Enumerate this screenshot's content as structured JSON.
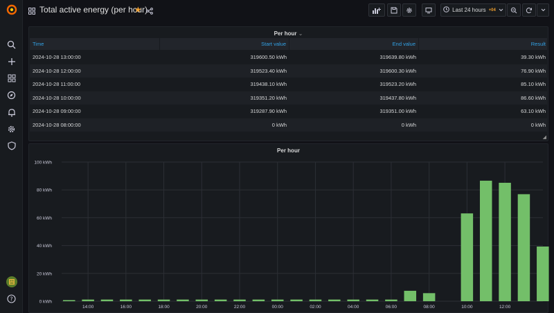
{
  "dashboard": {
    "title": "Total active energy (per hour)",
    "time_range": "Last 24 hours",
    "timezone_badge": "+04"
  },
  "sidebar": {
    "items": [
      "grafana-logo",
      "search-icon",
      "plus-icon",
      "dashboards-icon",
      "explore-icon",
      "bell-icon",
      "gear-icon",
      "shield-icon"
    ],
    "bottom": [
      "avatar",
      "help-icon"
    ]
  },
  "table_panel": {
    "title": "Per hour",
    "columns": [
      "Time",
      "Start value",
      "End value",
      "Result"
    ],
    "rows": [
      [
        "2024-10-28 13:00:00",
        "319600.50 kWh",
        "319639.80 kWh",
        "39.30 kWh"
      ],
      [
        "2024-10-28 12:00:00",
        "319523.40 kWh",
        "319600.30 kWh",
        "76.90 kWh"
      ],
      [
        "2024-10-28 11:00:00",
        "319438.10 kWh",
        "319523.20 kWh",
        "85.10 kWh"
      ],
      [
        "2024-10-28 10:00:00",
        "319351.20 kWh",
        "319437.80 kWh",
        "86.60 kWh"
      ],
      [
        "2024-10-28 09:00:00",
        "319287.90 kWh",
        "319351.00 kWh",
        "63.10 kWh"
      ],
      [
        "2024-10-28 08:00:00",
        "0 kWh",
        "0 kWh",
        "0 kWh"
      ]
    ]
  },
  "chart_panel": {
    "title": "Per hour"
  },
  "colors": {
    "bar": "#73bf69",
    "accent": "#33a2e5",
    "star": "#f2a02e"
  },
  "chart_data": {
    "type": "bar",
    "title": "Per hour",
    "xlabel": "",
    "ylabel": "",
    "x_ticks": [
      "14:00",
      "16:00",
      "18:00",
      "20:00",
      "22:00",
      "00:00",
      "02:00",
      "04:00",
      "06:00",
      "08:00",
      "10:00",
      "12:00"
    ],
    "y_ticks": [
      "0 kWh",
      "20 kWh",
      "40 kWh",
      "60 kWh",
      "80 kWh",
      "100 kWh"
    ],
    "ylim": [
      0,
      100
    ],
    "hours": [
      "13:00",
      "14:00",
      "15:00",
      "16:00",
      "17:00",
      "18:00",
      "19:00",
      "20:00",
      "21:00",
      "22:00",
      "23:00",
      "00:00",
      "01:00",
      "02:00",
      "03:00",
      "04:00",
      "05:00",
      "06:00",
      "07:00",
      "08:00",
      "09:00",
      "10:00",
      "11:00",
      "12:00",
      "13:00"
    ],
    "values": [
      0.8,
      1.2,
      1.2,
      1.2,
      1.2,
      1.2,
      1.2,
      1.2,
      1.2,
      1.2,
      1.2,
      1.2,
      1.2,
      1.2,
      1.2,
      1.2,
      1.2,
      1.2,
      7.5,
      5.8,
      0,
      63.1,
      86.6,
      85.1,
      76.9,
      39.3
    ],
    "grid": true,
    "legend": "none"
  }
}
